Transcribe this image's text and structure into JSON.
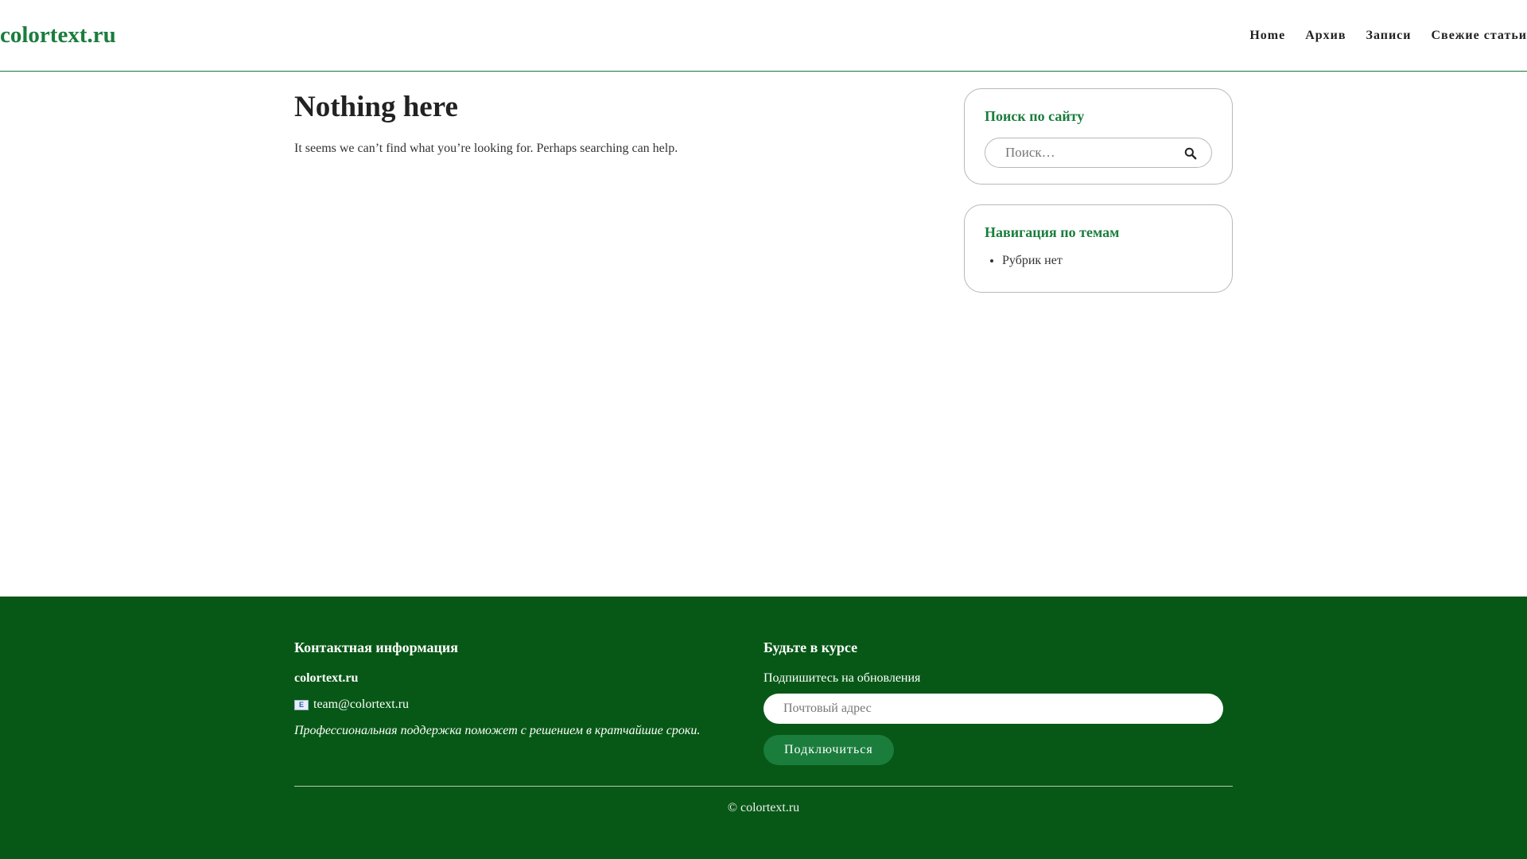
{
  "header": {
    "logo": "colortext.ru",
    "nav": [
      "Home",
      "Архив",
      "Записи",
      "Свежие статьи"
    ]
  },
  "main": {
    "title": "Nothing here",
    "message": "It seems we can’t find what you’re looking for. Perhaps searching can help."
  },
  "sidebar": {
    "search_widget": {
      "title": "Поиск по сайту",
      "placeholder": "Поиск…",
      "icon": "search-icon"
    },
    "topics_widget": {
      "title": "Навигация по темам",
      "items": [
        "Рубрик нет"
      ]
    }
  },
  "footer": {
    "contact": {
      "title": "Контактная информация",
      "brand": "colortext.ru",
      "email": "team@colortext.ru",
      "note": "Профессиональная поддержка поможет с решением в кратчайшие сроки."
    },
    "subscribe": {
      "title": "Будьте в курсе",
      "subtitle": "Подпишитесь на обновления",
      "placeholder": "Почтовый адрес",
      "button": "Подключиться"
    },
    "copyright": "© colortext.ru"
  },
  "colors": {
    "brand_green": "#1a7d3c",
    "footer_bg": "#075816"
  }
}
